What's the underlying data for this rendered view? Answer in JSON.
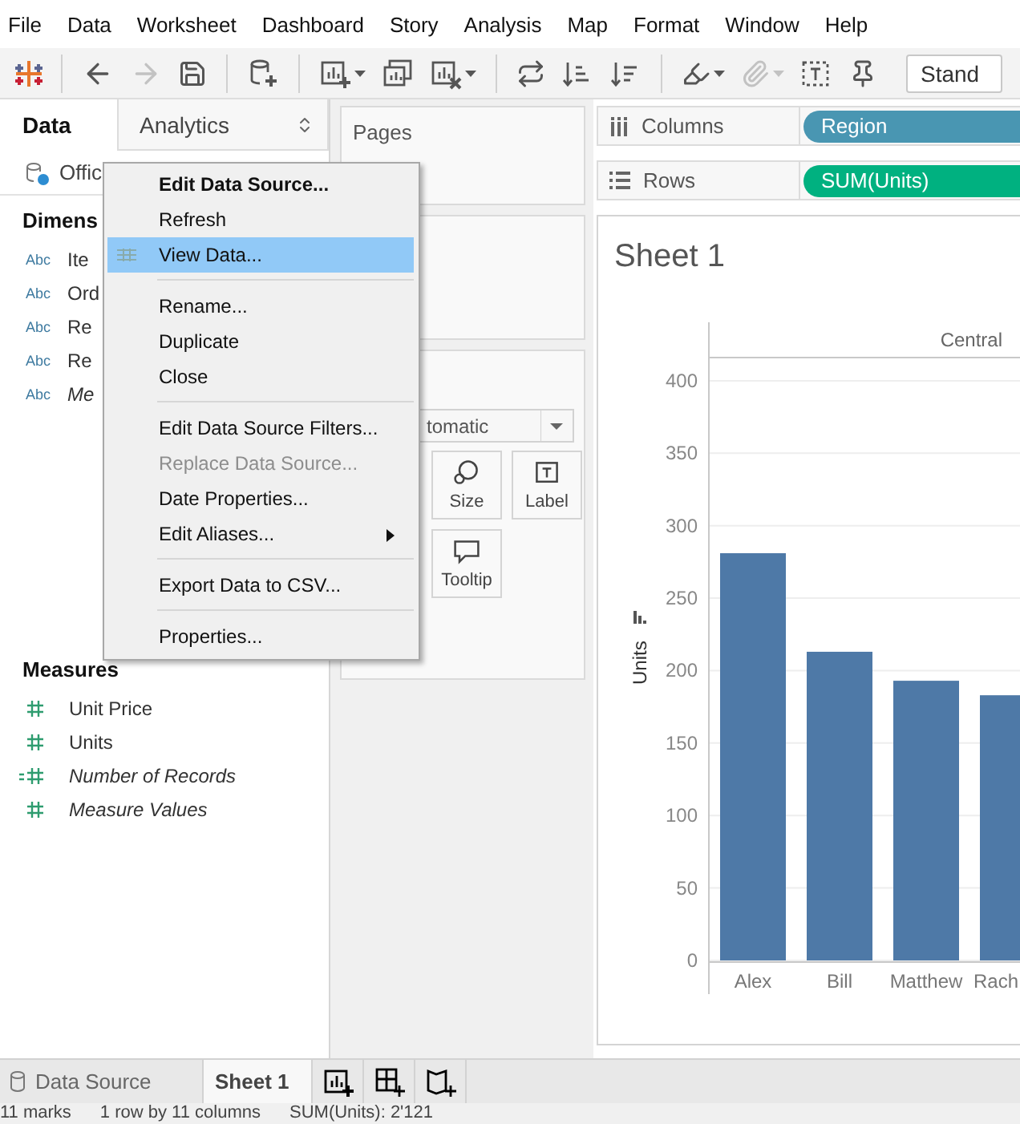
{
  "menu_bar": [
    "File",
    "Data",
    "Worksheet",
    "Dashboard",
    "Story",
    "Analysis",
    "Map",
    "Format",
    "Window",
    "Help"
  ],
  "toolbar": {
    "buttons": [
      {
        "kind": "back",
        "disabled": false
      },
      {
        "kind": "forward",
        "disabled": true
      },
      {
        "kind": "save",
        "disabled": false
      },
      {
        "kind": "new_data_source",
        "disabled": false
      },
      {
        "kind": "new_worksheet",
        "disabled": false
      },
      {
        "kind": "duplicate",
        "disabled": false
      },
      {
        "kind": "clear",
        "disabled": false
      },
      {
        "kind": "swap",
        "disabled": false
      },
      {
        "kind": "sort_ascending",
        "disabled": false
      },
      {
        "kind": "sort_descending",
        "disabled": false
      },
      {
        "kind": "highlight",
        "disabled": false
      },
      {
        "kind": "annotate",
        "disabled": true
      },
      {
        "kind": "labels",
        "disabled": false
      },
      {
        "kind": "pin",
        "disabled": false
      }
    ],
    "view_dropdown": "Stand"
  },
  "data_pane": {
    "tabs": [
      {
        "label": "Data",
        "selected": true
      },
      {
        "label": "Analytics",
        "selected": false
      }
    ],
    "data_source": "Offic",
    "dimensions": {
      "title": "Dimens",
      "fields": [
        {
          "type_label": "Abc",
          "name": "Ite",
          "kind": "field"
        },
        {
          "type_label": "Abc",
          "name": "Ord",
          "kind": "field"
        },
        {
          "type_label": "Abc",
          "name": "Re",
          "kind": "field"
        },
        {
          "type_label": "Abc",
          "name": "Re",
          "kind": "field"
        },
        {
          "type_label": "Abc",
          "name": "Me",
          "kind": "generated"
        }
      ]
    },
    "measures": {
      "title": "Measures",
      "fields": [
        {
          "name": "Unit Price",
          "kind": "field"
        },
        {
          "name": "Units",
          "kind": "field"
        },
        {
          "name": "Number of Records",
          "kind": "calculated"
        },
        {
          "name": "Measure Values",
          "kind": "generated"
        }
      ]
    }
  },
  "cards": {
    "pages": {
      "title": "Pages"
    },
    "marks": {
      "mark_type": "tomatic",
      "buttons": [
        {
          "label": "Size",
          "kind": "size"
        },
        {
          "label": "Label",
          "kind": "label"
        },
        {
          "label": "Tooltip",
          "kind": "tooltip"
        }
      ]
    }
  },
  "shelves": [
    {
      "label": "Columns",
      "kind": "columns",
      "pills": [
        {
          "label": "Region",
          "kind": "dimension"
        }
      ]
    },
    {
      "label": "Rows",
      "kind": "rows",
      "pills": [
        {
          "label": "SUM(Units)",
          "kind": "measure"
        }
      ]
    }
  ],
  "sheet": {
    "title": "Sheet 1",
    "header": "Central",
    "chart_data": {
      "type": "bar",
      "ylabel": "Units",
      "categories": [
        "Alex",
        "Bill",
        "Matthew",
        "Rach"
      ],
      "values": [
        281,
        213,
        193,
        183
      ],
      "ylim": [
        0,
        416
      ],
      "grid": true,
      "yticks": [
        0,
        50,
        100,
        150,
        200,
        250,
        300,
        350,
        400
      ]
    }
  },
  "context_menu": [
    {
      "kind": "item",
      "label": "Edit Data Source...",
      "default": true,
      "selected": false,
      "disabled": false,
      "submenu": false
    },
    {
      "kind": "item",
      "label": "Refresh",
      "default": false,
      "selected": false,
      "disabled": false,
      "submenu": false
    },
    {
      "kind": "item",
      "label": "View Data...",
      "default": false,
      "selected": true,
      "disabled": false,
      "submenu": false
    },
    {
      "kind": "separator"
    },
    {
      "kind": "item",
      "label": "Rename...",
      "default": false,
      "selected": false,
      "disabled": false,
      "submenu": false
    },
    {
      "kind": "item",
      "label": "Duplicate",
      "default": false,
      "selected": false,
      "disabled": false,
      "submenu": false
    },
    {
      "kind": "item",
      "label": "Close",
      "default": false,
      "selected": false,
      "disabled": false,
      "submenu": false
    },
    {
      "kind": "separator"
    },
    {
      "kind": "item",
      "label": "Edit Data Source Filters...",
      "default": false,
      "selected": false,
      "disabled": false,
      "submenu": false
    },
    {
      "kind": "item",
      "label": "Replace Data Source...",
      "default": false,
      "selected": false,
      "disabled": true,
      "submenu": false
    },
    {
      "kind": "item",
      "label": "Date Properties...",
      "default": false,
      "selected": false,
      "disabled": false,
      "submenu": false
    },
    {
      "kind": "item",
      "label": "Edit Aliases...",
      "default": false,
      "selected": false,
      "disabled": false,
      "submenu": true
    },
    {
      "kind": "separator"
    },
    {
      "kind": "item",
      "label": "Export Data to CSV...",
      "default": false,
      "selected": false,
      "disabled": false,
      "submenu": false
    },
    {
      "kind": "separator"
    },
    {
      "kind": "item",
      "label": "Properties...",
      "default": false,
      "selected": false,
      "disabled": false,
      "submenu": false
    }
  ],
  "sheet_tabs": [
    {
      "label": "Data Source",
      "kind": "data_source",
      "selected": false
    },
    {
      "label": "Sheet 1",
      "kind": "sheet",
      "selected": true
    }
  ],
  "status_bar": [
    "11 marks",
    "1 row by 11 columns",
    "SUM(Units): 2'121"
  ]
}
